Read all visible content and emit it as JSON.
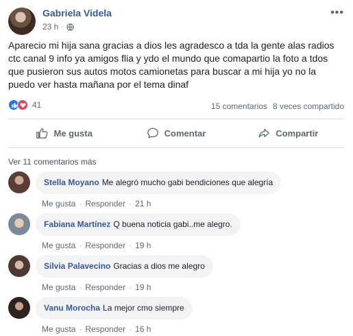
{
  "post": {
    "author": "Gabriela Videla",
    "time": "23 h",
    "text": "Aparecio mi hija sana gracias a dios les agradesco a tda la gente alas radios ctc canal 9 info ya amigos flia y ydo el mundo que comapartio la foto a tdos que pusieron sus autos motos camionetas para buscar a mi hija yo no la puedo ver hasta mañana por el tema dinaf",
    "reactions_count": "41",
    "comments_count": "15 comentarios",
    "shares_count": "8 veces compartido",
    "more_glyph": "•••"
  },
  "actions": {
    "like": "Me gusta",
    "comment": "Comentar",
    "share": "Compartir"
  },
  "view_more_comments": "Ver 11 comentarios más",
  "comments": [
    {
      "name": "Stella Moyano",
      "text": "Me alegró mucho gabi bendiciones que alegría",
      "like": "Me gusta",
      "reply": "Responder",
      "time": "21 h"
    },
    {
      "name": "Fabiana Martínez",
      "text": "Q buena noticia gabi..me alegro.",
      "like": "Me gusta",
      "reply": "Responder",
      "time": "19 h"
    },
    {
      "name": "Silvia Palavecino",
      "text": "Gracias a dios me alegro",
      "like": "Me gusta",
      "reply": "Responder",
      "time": "19 h"
    },
    {
      "name": "Vanu Morocha",
      "text": "La mejor cmo siempre",
      "like": "Me gusta",
      "reply": "Responder",
      "time": "16 h"
    }
  ],
  "icons": {
    "globe": "globe-icon",
    "like_reaction": "like-reaction-icon",
    "love_reaction": "love-reaction-icon",
    "thumbs_up": "thumbs-up-icon",
    "comment": "comment-icon",
    "share": "share-icon"
  },
  "colors": {
    "link_blue": "#385898",
    "like_blue": "#1877f2",
    "love_red": "#f33e58",
    "bubble_gray": "#f2f3f5"
  }
}
